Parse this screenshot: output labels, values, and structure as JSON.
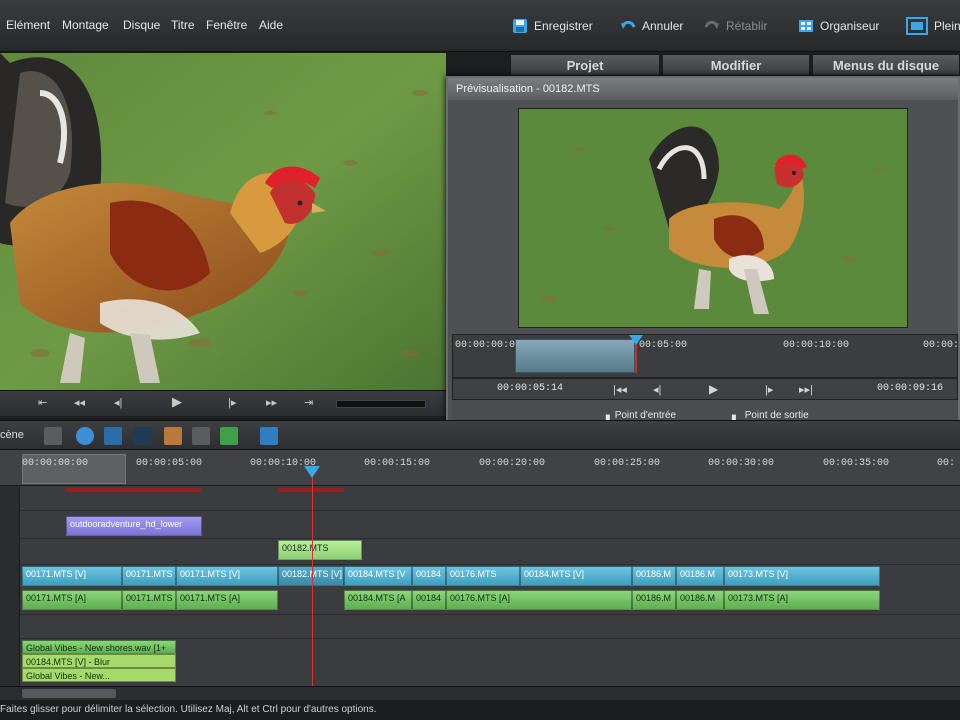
{
  "menu": {
    "items": [
      {
        "label": "Elément"
      },
      {
        "label": "Montage"
      },
      {
        "label": "Disque"
      },
      {
        "label": "Titre"
      },
      {
        "label": "Fenêtre"
      },
      {
        "label": "Aide"
      }
    ]
  },
  "toolbar": {
    "save_label": "Enregistrer",
    "undo_label": "Annuler",
    "redo_label": "Rétablir",
    "organizer_label": "Organiseur",
    "fullscreen_label": "Plein"
  },
  "panel_tabs": [
    {
      "label": "Projet"
    },
    {
      "label": "Modifier"
    },
    {
      "label": "Menus du disque"
    }
  ],
  "preview": {
    "title": "Prévisualisation - 00182.MTS",
    "ruler_labels": [
      "00:00:00:00",
      "00:00:05:00",
      "00:00:10:00",
      "00:00:"
    ],
    "current_time": "00:00:05:14",
    "duration": "00:00:09:16",
    "in_point_label": "Point d'entrée",
    "out_point_label": "Point de sortie"
  },
  "timeline": {
    "scene_label": "cène",
    "ruler_labels": [
      "00:00:00:00",
      "00:00:05:00",
      "00:00:10:00",
      "00:00:15:00",
      "00:00:20:00",
      "00:00:25:00",
      "00:00:30:00",
      "00:00:35:00",
      "00:"
    ],
    "title_clip": "outdooradventure_hd_lower",
    "overlay_clip": "00182.MTS",
    "video_clips": [
      "00171.MTS [V]",
      "00171.MTS",
      "00171.MTS [V]",
      "00182.MTS [V]",
      "00184.MTS [V",
      "00184",
      "00176.MTS",
      "00184.MTS [V]",
      "00186.M",
      "00186.M",
      "00173.MTS [V]"
    ],
    "audio_clips": [
      "00171.MTS [A]",
      "00171.MTS",
      "00171.MTS [A]",
      "00184.MTS [A",
      "00184",
      "00176.MTS [A]",
      "00186.M",
      "00186.M",
      "00173.MTS [A]"
    ],
    "music_clip": "Global Vibes - New shores.wav [1+",
    "music_clip_sub": "00184.MTS [V] - Blur",
    "music_clip_sub2": "Global Vibes - New..."
  },
  "status": {
    "text": "Faites glisser pour délimiter la sélection. Utilisez Maj, Alt et Ctrl pour d'autres options."
  },
  "colors": {
    "accent": "#3ba6e8",
    "video_clip": "#3e9fbf",
    "audio_clip": "#5fae52",
    "title_clip": "#7d72d6",
    "playhead": "#dd3333"
  }
}
